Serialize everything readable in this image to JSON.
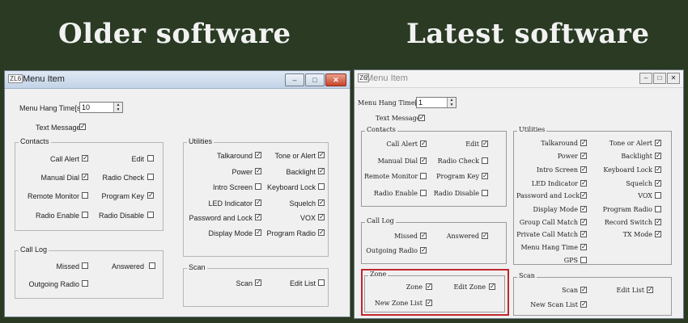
{
  "headings": {
    "left": "Older software",
    "right": "Latest software"
  },
  "old": {
    "title": "Menu Item",
    "title_icon": "ZL6",
    "menu_hang_label": "Menu Hang Time[s]",
    "menu_hang_value": "10",
    "text_message": {
      "label": "Text Message",
      "checked": true
    },
    "contacts": {
      "title": "Contacts",
      "items": [
        {
          "label": "Call Alert",
          "checked": true
        },
        {
          "label": "Edit",
          "checked": false
        },
        {
          "label": "Manual Dial",
          "checked": true
        },
        {
          "label": "Radio Check",
          "checked": false
        },
        {
          "label": "Remote Monitor",
          "checked": false
        },
        {
          "label": "Program Key",
          "checked": true
        },
        {
          "label": "Radio Enable",
          "checked": false
        },
        {
          "label": "Radio Disable",
          "checked": false
        }
      ]
    },
    "call_log": {
      "title": "Call Log",
      "items": [
        {
          "label": "Missed",
          "checked": false
        },
        {
          "label": "Answered",
          "checked": false
        },
        {
          "label": "Outgoing Radio",
          "checked": false
        }
      ]
    },
    "utilities": {
      "title": "Utilities",
      "items": [
        {
          "label": "Talkaround",
          "checked": true
        },
        {
          "label": "Tone or Alert",
          "checked": true
        },
        {
          "label": "Power",
          "checked": true
        },
        {
          "label": "Backlight",
          "checked": true
        },
        {
          "label": "Intro Screen",
          "checked": false
        },
        {
          "label": "Keyboard Lock",
          "checked": false
        },
        {
          "label": "LED Indicator",
          "checked": true
        },
        {
          "label": "Squelch",
          "checked": true
        },
        {
          "label": "Password and Lock",
          "checked": true
        },
        {
          "label": "VOX",
          "checked": true
        },
        {
          "label": "Display Mode",
          "checked": true
        },
        {
          "label": "Program Radio",
          "checked": true
        }
      ]
    },
    "scan": {
      "title": "Scan",
      "items": [
        {
          "label": "Scan",
          "checked": true
        },
        {
          "label": "Edit List",
          "checked": false
        }
      ]
    }
  },
  "new": {
    "title": "Menu Item",
    "title_icon": "Z6",
    "menu_hang_label": "Menu Hang Time[s]",
    "menu_hang_value": "1",
    "text_message": {
      "label": "Text Message",
      "checked": true
    },
    "contacts": {
      "title": "Contacts",
      "items": [
        {
          "label": "Call Alert",
          "checked": true
        },
        {
          "label": "Edit",
          "checked": true
        },
        {
          "label": "Manual Dial",
          "checked": true
        },
        {
          "label": "Radio Check",
          "checked": false
        },
        {
          "label": "Remote Monitor",
          "checked": false
        },
        {
          "label": "Program Key",
          "checked": true
        },
        {
          "label": "Radio Enable",
          "checked": false
        },
        {
          "label": "Radio Disable",
          "checked": false
        }
      ]
    },
    "call_log": {
      "title": "Call Log",
      "items": [
        {
          "label": "Missed",
          "checked": true
        },
        {
          "label": "Answered",
          "checked": true
        },
        {
          "label": "Outgoing Radio",
          "checked": true
        }
      ]
    },
    "zone": {
      "title": "Zone",
      "items": [
        {
          "label": "Zone",
          "checked": true
        },
        {
          "label": "Edit Zone",
          "checked": true
        },
        {
          "label": "New Zone List",
          "checked": true
        }
      ]
    },
    "utilities": {
      "title": "Utilities",
      "items": [
        {
          "label": "Talkaround",
          "checked": true
        },
        {
          "label": "Tone or Alert",
          "checked": true
        },
        {
          "label": "Power",
          "checked": true
        },
        {
          "label": "Backlight",
          "checked": true
        },
        {
          "label": "Intro Screen",
          "checked": true
        },
        {
          "label": "Keyboard Lock",
          "checked": true
        },
        {
          "label": "LED Indicator",
          "checked": true
        },
        {
          "label": "Squelch",
          "checked": true
        },
        {
          "label": "Password and Lock",
          "checked": true
        },
        {
          "label": "VOX",
          "checked": false
        },
        {
          "label": "Display Mode",
          "checked": true
        },
        {
          "label": "Program Radio",
          "checked": false
        },
        {
          "label": "Group Call Match",
          "checked": true
        },
        {
          "label": "Record Switch",
          "checked": true
        },
        {
          "label": "Private Call Match",
          "checked": true
        },
        {
          "label": "TX Mode",
          "checked": true
        },
        {
          "label": "Menu Hang Time",
          "checked": true
        },
        {
          "label": "GPS",
          "checked": false
        }
      ]
    },
    "scan": {
      "title": "Scan",
      "items": [
        {
          "label": "Scan",
          "checked": true
        },
        {
          "label": "Edit List",
          "checked": true
        },
        {
          "label": "New Scan List",
          "checked": true
        }
      ]
    },
    "highlight_color": "#c0272d"
  }
}
